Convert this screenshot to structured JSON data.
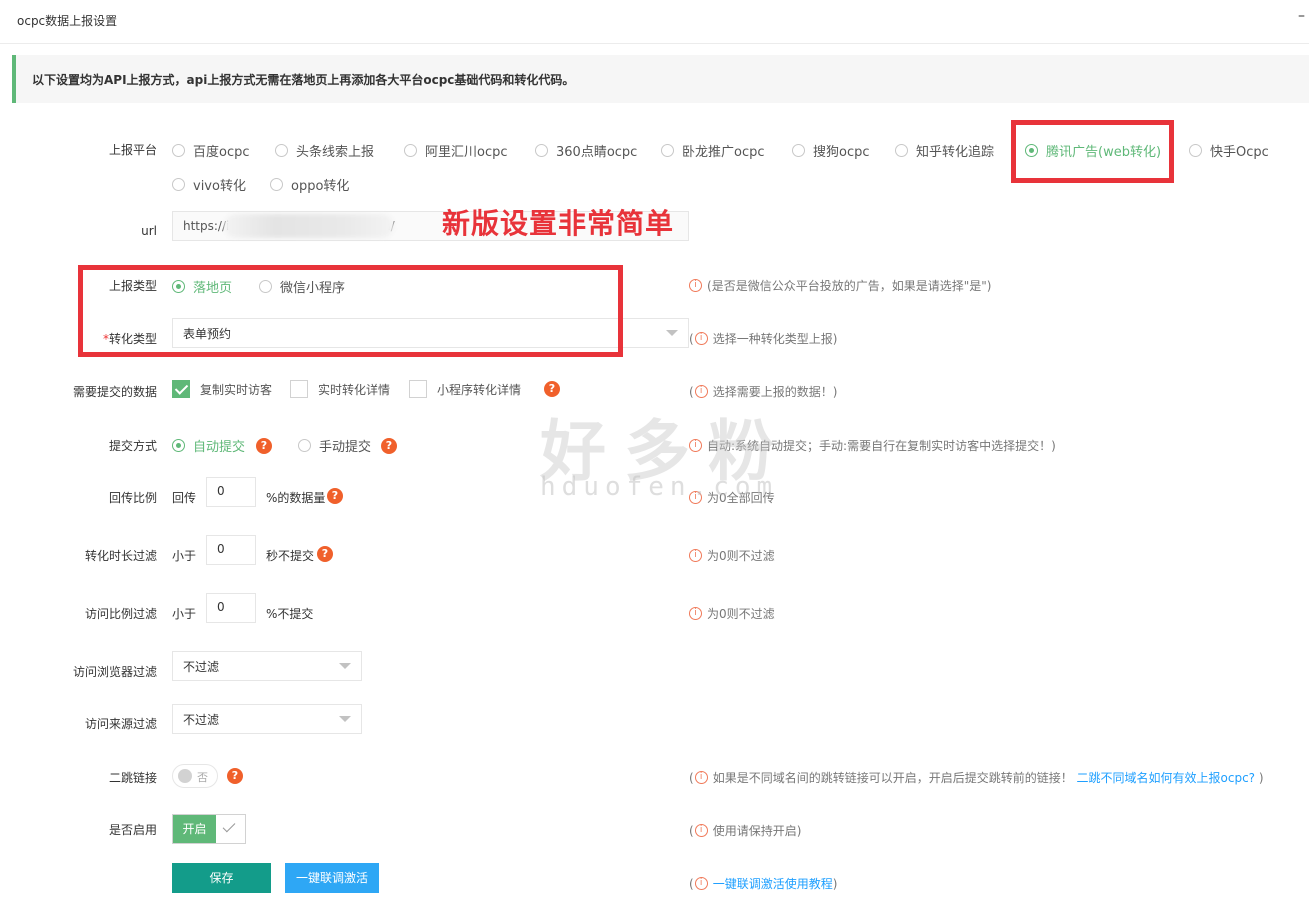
{
  "window": {
    "title": "ocpc数据上报设置",
    "minimize_glyph": "–"
  },
  "notice": "以下设置均为API上报方式，api上报方式无需在落地页上再添加各大平台ocpc基础代码和转化代码。",
  "platform": {
    "label": "上报平台",
    "options": [
      "百度ocpc",
      "头条线索上报",
      "阿里汇川ocpc",
      "360点睛ocpc",
      "卧龙推广ocpc",
      "搜狗ocpc",
      "知乎转化追踪",
      "腾讯广告(web转化)",
      "快手Ocpc",
      "vivo转化",
      "oppo转化"
    ],
    "selected": "腾讯广告(web转化)"
  },
  "url": {
    "label": "url",
    "value_prefix": "https://i",
    "value_suffix": "n/"
  },
  "annotation": "新版设置非常简单",
  "report_type": {
    "label": "上报类型",
    "options": [
      "落地页",
      "微信小程序"
    ],
    "selected": "落地页",
    "tip": "是否是微信公众平台投放的广告，如果是请选择\"是\""
  },
  "conversion_type": {
    "required_mark": "*",
    "label": "转化类型",
    "value": "表单预约",
    "tip": "选择一种转化类型上报"
  },
  "submit_data": {
    "label": "需要提交的数据",
    "options": [
      {
        "label": "复制实时访客",
        "checked": true
      },
      {
        "label": "实时转化详情",
        "checked": false
      },
      {
        "label": "小程序转化详情",
        "checked": false
      }
    ],
    "tip": "选择需要上报的数据！"
  },
  "submit_mode": {
    "label": "提交方式",
    "options": [
      "自动提交",
      "手动提交"
    ],
    "selected": "自动提交",
    "tip": "自动:系统自动提交；手动:需要自行在复制实时访客中选择提交！"
  },
  "return_ratio": {
    "label": "回传比例",
    "prefix": "回传",
    "value": "0",
    "suffix": "%的数据量",
    "tip": "为0全部回传"
  },
  "duration_filter": {
    "label": "转化时长过滤",
    "prefix": "小于",
    "value": "0",
    "suffix": "秒不提交",
    "tip": "为0则不过滤"
  },
  "visit_ratio_filter": {
    "label": "访问比例过滤",
    "prefix": "小于",
    "value": "0",
    "suffix": "%不提交",
    "tip": "为0则不过滤"
  },
  "browser_filter": {
    "label": "访问浏览器过滤",
    "value": "不过滤"
  },
  "source_filter": {
    "label": "访问来源过滤",
    "value": "不过滤"
  },
  "redirect_link": {
    "label": "二跳链接",
    "toggle_text": "否",
    "tip": "如果是不同域名间的跳转链接可以开启，开启后提交跳转前的链接！",
    "tip_link": "二跳不同域名如何有效上报ocpc?"
  },
  "enabled": {
    "label": "是否启用",
    "on_text": "开启",
    "tip": "使用请保持开启"
  },
  "buttons": {
    "save": "保存",
    "test": "一键联调激活"
  },
  "test_tip": "一键联调激活使用教程",
  "help_glyph": "?",
  "info_glyph": "i",
  "watermark": {
    "cn": "好多粉",
    "en": "hduofen.com"
  },
  "colors": {
    "accent_green": "#5fb878",
    "save_teal": "#139c8a",
    "test_blue": "#2ea7f5",
    "annotation_red": "#e8333a",
    "help_orange": "#f0602b"
  }
}
